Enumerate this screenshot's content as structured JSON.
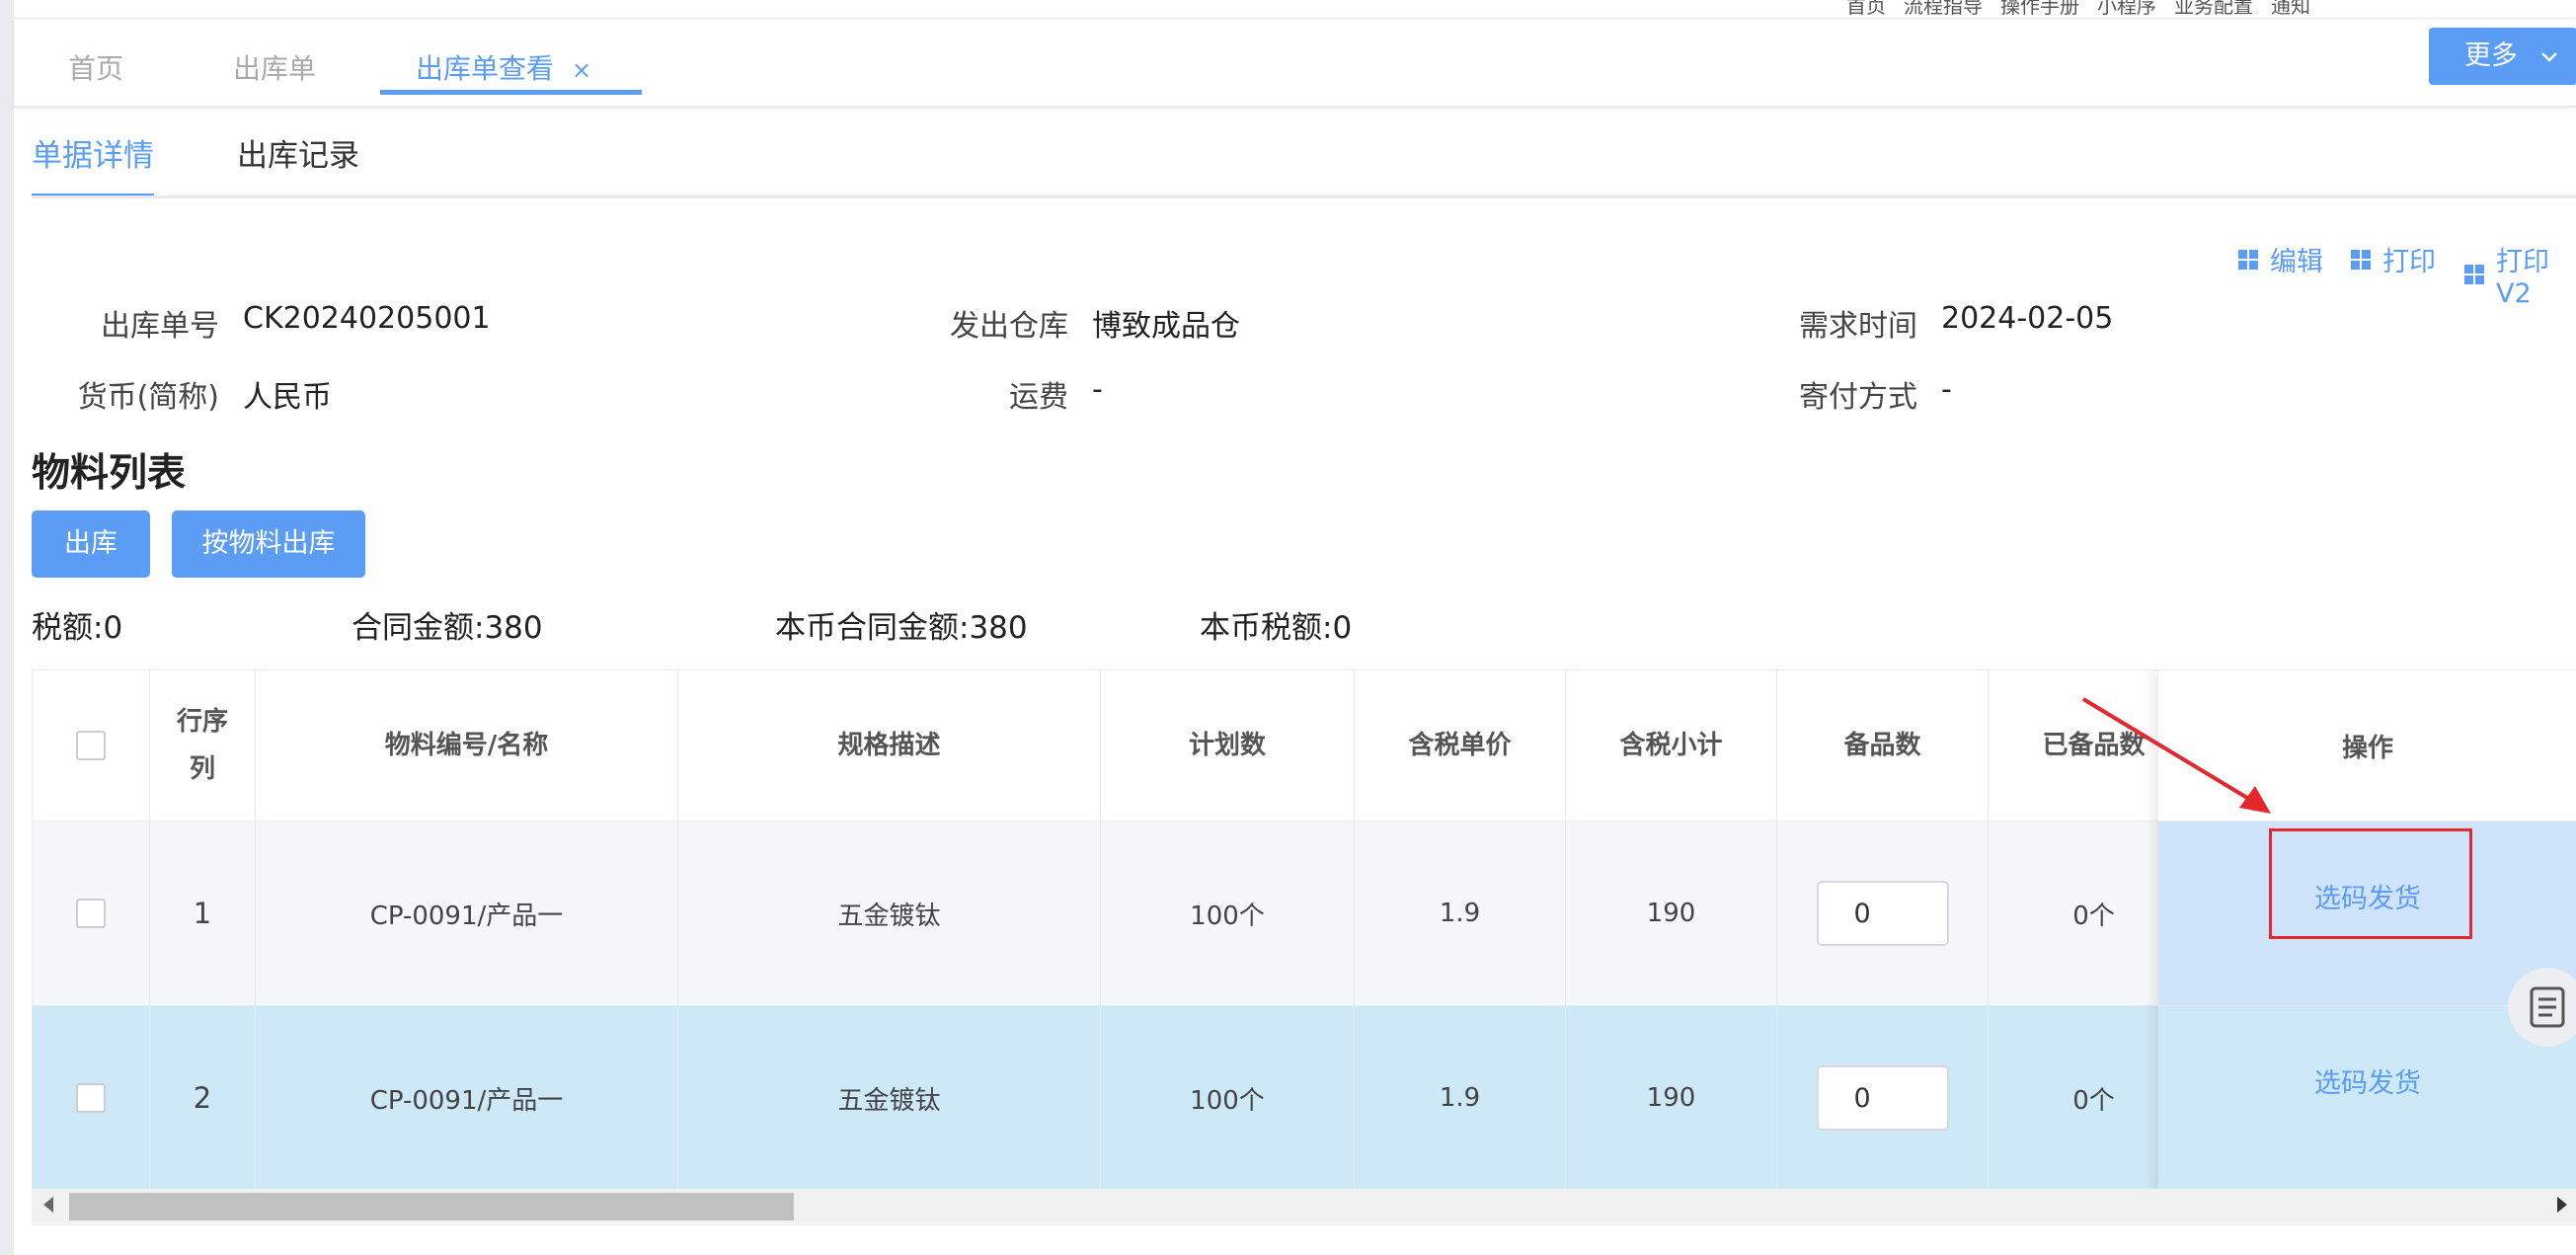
{
  "top_links": [
    "首页",
    "流程指导",
    "操作手册",
    "小程序",
    "业务配置",
    "通知"
  ],
  "tabs": [
    {
      "label": "首页"
    },
    {
      "label": "出库单"
    },
    {
      "label": "出库单查看",
      "close": "×"
    }
  ],
  "more_button": {
    "label": "更多",
    "arrow": "chevron-down-icon"
  },
  "sub_tabs": [
    {
      "label": "单据详情"
    },
    {
      "label": "出库记录"
    }
  ],
  "actions": [
    {
      "label": "编辑"
    },
    {
      "label": "打印"
    },
    {
      "label": "打印V2"
    }
  ],
  "info": {
    "order_no": {
      "label": "出库单号",
      "value": "CK20240205001"
    },
    "warehouse": {
      "label": "发出仓库",
      "value": "博致成品仓"
    },
    "demand_time": {
      "label": "需求时间",
      "value": "2024-02-05"
    },
    "currency": {
      "label": "货币(简称)",
      "value": "人民币"
    },
    "freight": {
      "label": "运费",
      "value": "-"
    },
    "shipping": {
      "label": "寄付方式",
      "value": "-"
    }
  },
  "section_title": "物料列表",
  "buttons": {
    "outbound": "出库",
    "by_material": "按物料出库"
  },
  "summary": {
    "tax": "税额:0",
    "contract_amount": "合同金额:380",
    "local_contract_amount": "本币合同金额:380",
    "local_tax": "本币税额:0"
  },
  "table": {
    "headers": {
      "seq_line1": "行序",
      "seq_line2": "列",
      "material": "物料编号/名称",
      "spec": "规格描述",
      "plan": "计划数",
      "unit_price": "含税单价",
      "subtotal": "含税小计",
      "prepare": "备品数",
      "prepared": "已备品数",
      "operation": "操作"
    },
    "rows": [
      {
        "seq": "1",
        "material": "CP-0091/产品一",
        "spec": "五金镀钛",
        "plan": "100个",
        "unit_price": "1.9",
        "subtotal": "190",
        "prepare": "0",
        "prepared": "0个",
        "action": "选码发货"
      },
      {
        "seq": "2",
        "material": "CP-0091/产品一",
        "spec": "五金镀钛",
        "plan": "100个",
        "unit_price": "1.9",
        "subtotal": "190",
        "prepare": "0",
        "prepared": "0个",
        "action": "选码发货"
      }
    ]
  },
  "colors": {
    "accent": "#5b9cf4",
    "highlight_row": "#cde8f6",
    "annotation": "#e4282e"
  }
}
